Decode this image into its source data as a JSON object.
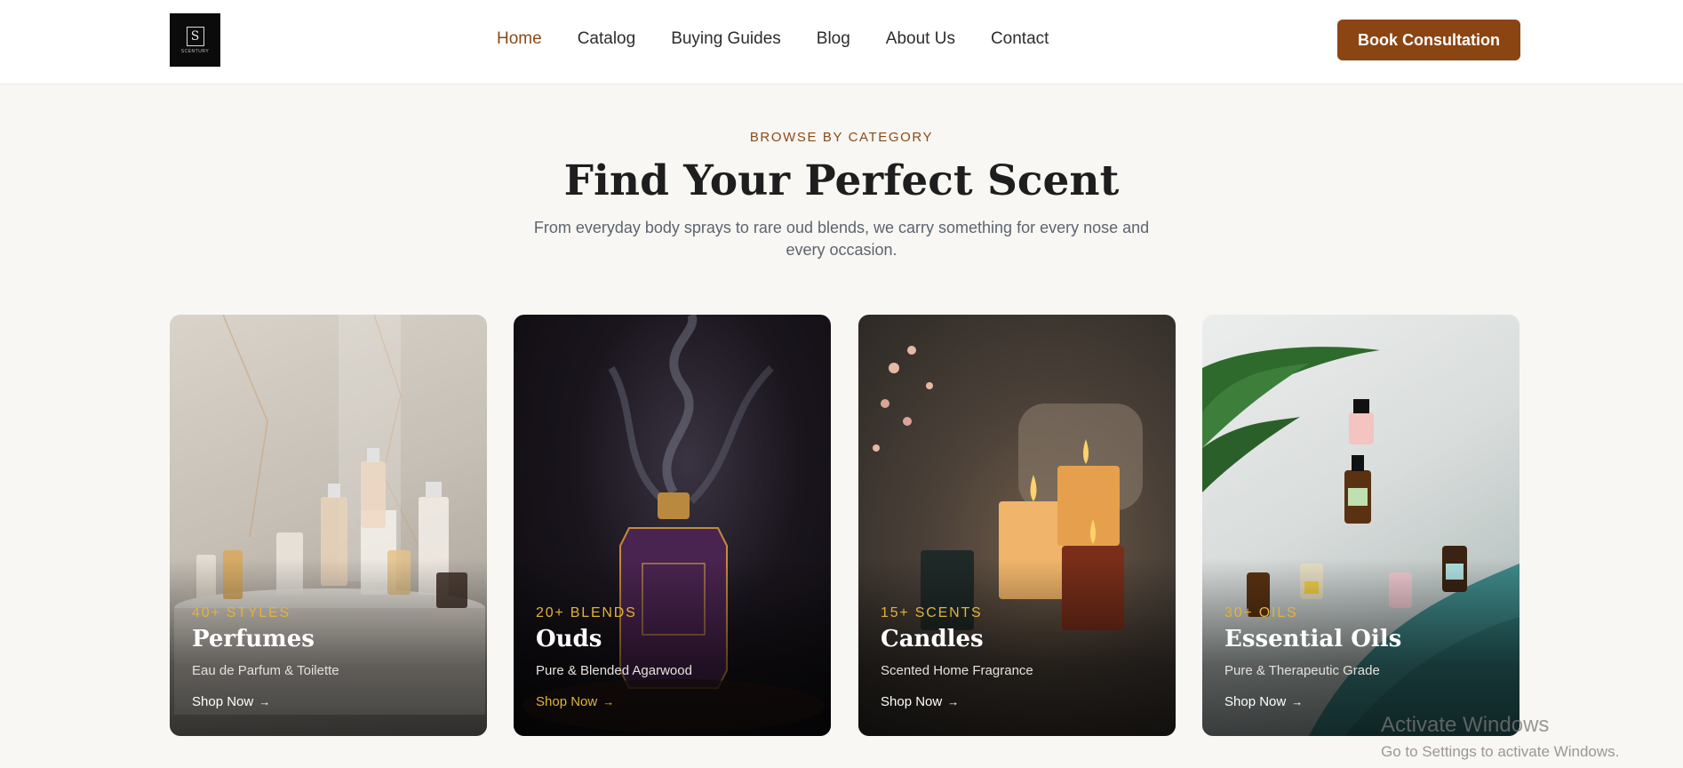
{
  "header": {
    "logo_text": "SCENTURY",
    "logo_letter": "S",
    "nav": [
      {
        "label": "Home",
        "active": true
      },
      {
        "label": "Catalog",
        "active": false
      },
      {
        "label": "Buying Guides",
        "active": false
      },
      {
        "label": "Blog",
        "active": false
      },
      {
        "label": "About Us",
        "active": false
      },
      {
        "label": "Contact",
        "active": false
      }
    ],
    "cta_label": "Book Consultation"
  },
  "section": {
    "eyebrow": "BROWSE BY CATEGORY",
    "title": "Find Your Perfect Scent",
    "subtitle": "From everyday body sprays to rare oud blends, we carry something for every nose and every occasion."
  },
  "cards": [
    {
      "badge": "40+ STYLES",
      "name": "Perfumes",
      "desc": "Eau de Parfum & Toilette",
      "link": "Shop Now",
      "icon": "perfume-bottles-image"
    },
    {
      "badge": "20+ BLENDS",
      "name": "Ouds",
      "desc": "Pure & Blended Agarwood",
      "link": "Shop Now",
      "icon": "oud-bottle-smoke-image"
    },
    {
      "badge": "15+ SCENTS",
      "name": "Candles",
      "desc": "Scented Home Fragrance",
      "link": "Shop Now",
      "icon": "candles-image"
    },
    {
      "badge": "30+ OILS",
      "name": "Essential Oils",
      "desc": "Pure & Therapeutic Grade",
      "link": "Shop Now",
      "icon": "essential-oil-bottles-image"
    }
  ],
  "watermark": {
    "line1": "Activate Windows",
    "line2": "Go to Settings to activate Windows."
  },
  "colors": {
    "accent": "#8b4513",
    "nav_active": "#8b4a17",
    "badge_gold": "#e3b23c",
    "page_bg": "#f8f7f3"
  }
}
